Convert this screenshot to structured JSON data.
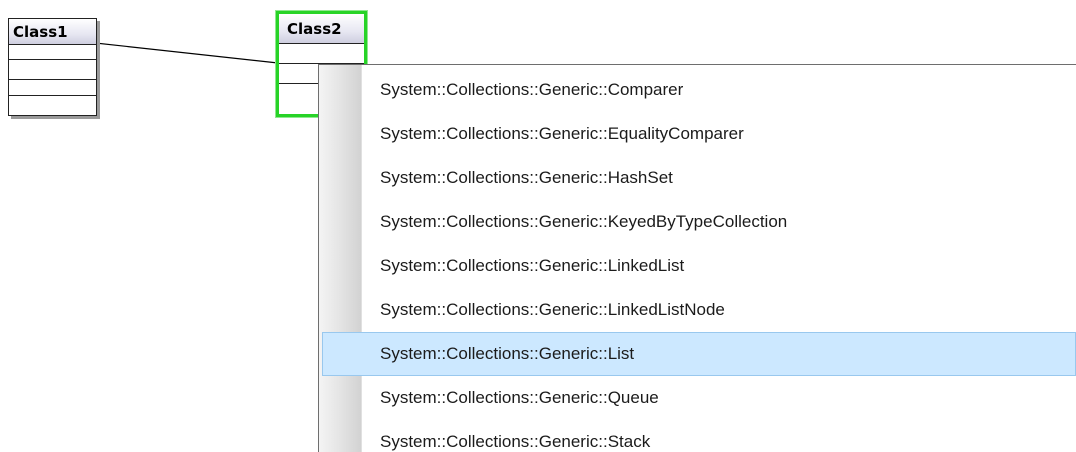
{
  "diagram": {
    "classes": [
      {
        "id": "class1",
        "name": "Class1"
      },
      {
        "id": "class2",
        "name": "Class2"
      }
    ]
  },
  "dropdown": {
    "items": [
      {
        "label": "System::Collections::Generic::Comparer",
        "selected": false
      },
      {
        "label": "System::Collections::Generic::EqualityComparer",
        "selected": false
      },
      {
        "label": "System::Collections::Generic::HashSet",
        "selected": false
      },
      {
        "label": "System::Collections::Generic::KeyedByTypeCollection",
        "selected": false
      },
      {
        "label": "System::Collections::Generic::LinkedList",
        "selected": false
      },
      {
        "label": "System::Collections::Generic::LinkedListNode",
        "selected": false
      },
      {
        "label": "System::Collections::Generic::List",
        "selected": true
      },
      {
        "label": "System::Collections::Generic::Queue",
        "selected": false
      },
      {
        "label": "System::Collections::Generic::Stack",
        "selected": false
      }
    ]
  },
  "colors": {
    "selection_border": "#27d327",
    "highlight_bg": "#cce8ff",
    "highlight_border": "#99c8ee"
  }
}
